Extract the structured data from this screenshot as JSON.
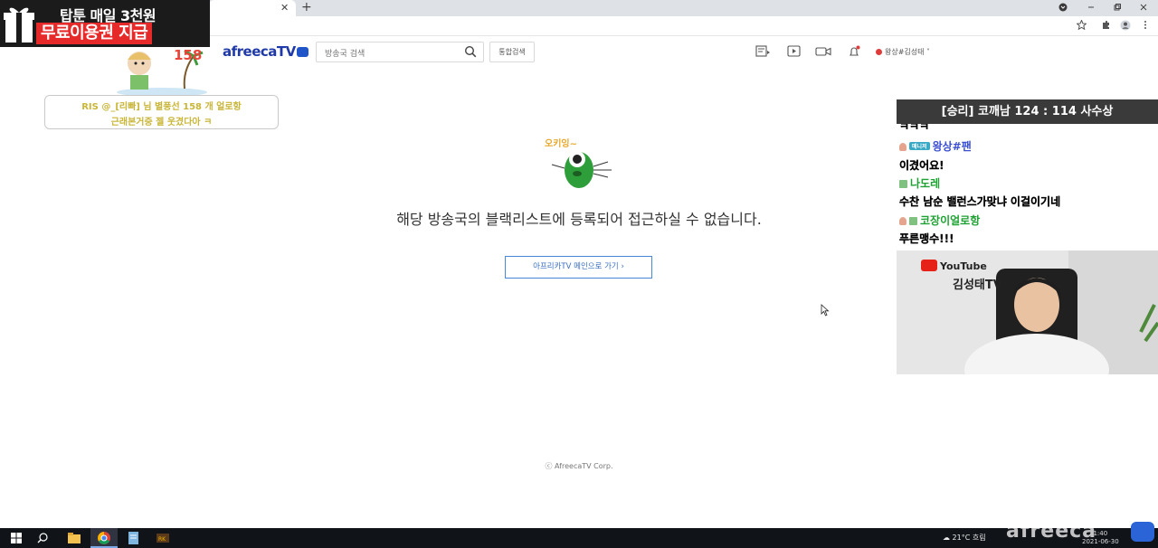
{
  "browser": {
    "new_tab_symbol": "+",
    "close_tab_symbol": "✕"
  },
  "header": {
    "logo_text": "afreecaTV",
    "search_placeholder": "방송국 검색",
    "total_search_label": "통합검색",
    "user_label": "왕상#김성태 ˅"
  },
  "main": {
    "block_message": "해당 방송국의 블랙리스트에 등록되어 접근하실 수 없습니다.",
    "main_link_label": "아프리카TV 메인으로 가기 ›",
    "copyright": "ⓒ AfreecaTV Corp."
  },
  "overlay": {
    "promo_line1": "탑툰 매일 3천원",
    "promo_line2": "무료이용권 지급",
    "donor_count": "158",
    "donor_line1": "RIS @_[리빠] 님 별풍선 158 개 얼로항",
    "donor_line2": "근래본거중 젤 웃겼다아 ㅋ",
    "score": "[승리] 코깨남 124 : 114 사수상",
    "chat": {
      "row0": "ㅋㅋㅋ",
      "row1_badge": "매니저",
      "row1_name": "왕상#팬",
      "row2": "이겼어요!",
      "row3_name": "나도레",
      "row4": "수찬 남순 밸런스가맞냐 이걸이기네",
      "row5_name": "코장이얼로항",
      "row6": "푸른맹수!!!"
    },
    "webcam_brand": "YouTube",
    "webcam_channel": "김성태TV"
  },
  "taskbar": {
    "weather": "21°C  흐림",
    "time": "1:40",
    "date": "2021-06-30",
    "watermark": "afreeca"
  },
  "colors": {
    "accent_blue": "#4a88d8",
    "logo_blue": "#1f3aa8",
    "promo_red": "#e62a2a",
    "chat_green": "#1da232"
  }
}
